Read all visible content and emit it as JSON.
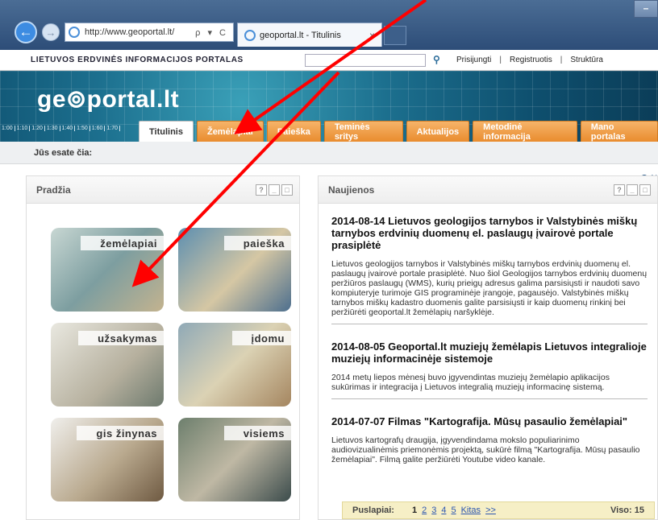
{
  "browser": {
    "address": "http://www.geoportal.lt/",
    "address_tools": "ρ ▾ C",
    "tab_title": "geoportal.lt - Titulinis",
    "tab_close": "×",
    "min_label": "–"
  },
  "header": {
    "portal_name": "LIETUVOS ERDVINĖS INFORMACIJOS PORTALAS",
    "search_placeholder": "",
    "links": [
      "Prisijungti",
      "Registruotis",
      "Struktūra"
    ],
    "logo": "ge⊚portal.lt",
    "scale": [
      "1:00",
      "1:10",
      "1:20",
      "1:30",
      "1:40",
      "1:50",
      "1:60",
      "1:70"
    ]
  },
  "tabs": [
    "Titulinis",
    "Žemėlapiai",
    "Paieška",
    "Teminės sritys",
    "Aktualijos",
    "Metodinė informacija",
    "Mano portalas"
  ],
  "breadcrumb": "Jūs esate čia:",
  "left_panel": {
    "title": "Pradžia",
    "tiles": [
      "žemėlapiai",
      "paieška",
      "užsakymas",
      "įdomu",
      "gis žinynas",
      "visiems"
    ]
  },
  "right_panel": {
    "title": "Naujienos",
    "top_link": "N",
    "news": [
      {
        "title": "2014-08-14   Lietuvos geologijos tarnybos ir Valstybinės miškų tarnybos erdvinių duomenų el. paslaugų įvairovė portale prasiplėtė",
        "body": "Lietuvos geologijos tarnybos ir Valstybinės miškų tarnybos erdvinių duomenų el. paslaugų įvairovė portale prasiplėtė. Nuo šiol Geologijos tarnybos erdvinių duomenų peržiūros paslaugų (WMS), kurių prieigų adresus galima parsisiųsti ir naudoti savo kompiuteryje turimoje GIS programinėje įrangoje, pagausėjo. Valstybinės miškų tarnybos miškų kadastro duomenis galite parsisiųsti ir kaip duomenų rinkinį bei peržiūrėti geoportal.lt žemėlapių naršyklėje."
      },
      {
        "title": "2014-08-05   Geoportal.lt muziejų žemėlapis Lietuvos integralioje muziejų informacinėje sistemoje",
        "body": "2014 metų liepos mėnesį buvo įgyvendintas muziejų žemėlapio aplikacijos sukūrimas ir integracija į Lietuvos integralią muziejų informacinę sistemą."
      },
      {
        "title": "2014-07-07   Filmas \"Kartografija. Mūsų pasaulio žemėlapiai\"",
        "body": "Lietuvos kartografų draugija, įgyvendindama mokslo populiarinimo audiovizualinėmis priemonėmis projektą, sukūrė filmą \"Kartografija. Mūsų pasaulio žemėlapiai\". Filmą galite peržiūrėti Youtube video kanale."
      }
    ],
    "pager": {
      "label": "Puslapiai:",
      "current": "1",
      "pages": [
        "2",
        "3",
        "4",
        "5"
      ],
      "next": "Kitas",
      "last": ">>",
      "total": "Viso: 15"
    }
  },
  "colors": {
    "arrow": "#ff0000",
    "tab_orange": "#e98c2e",
    "banner": "#1c6f8e",
    "pager_bg": "#f6efc6"
  }
}
